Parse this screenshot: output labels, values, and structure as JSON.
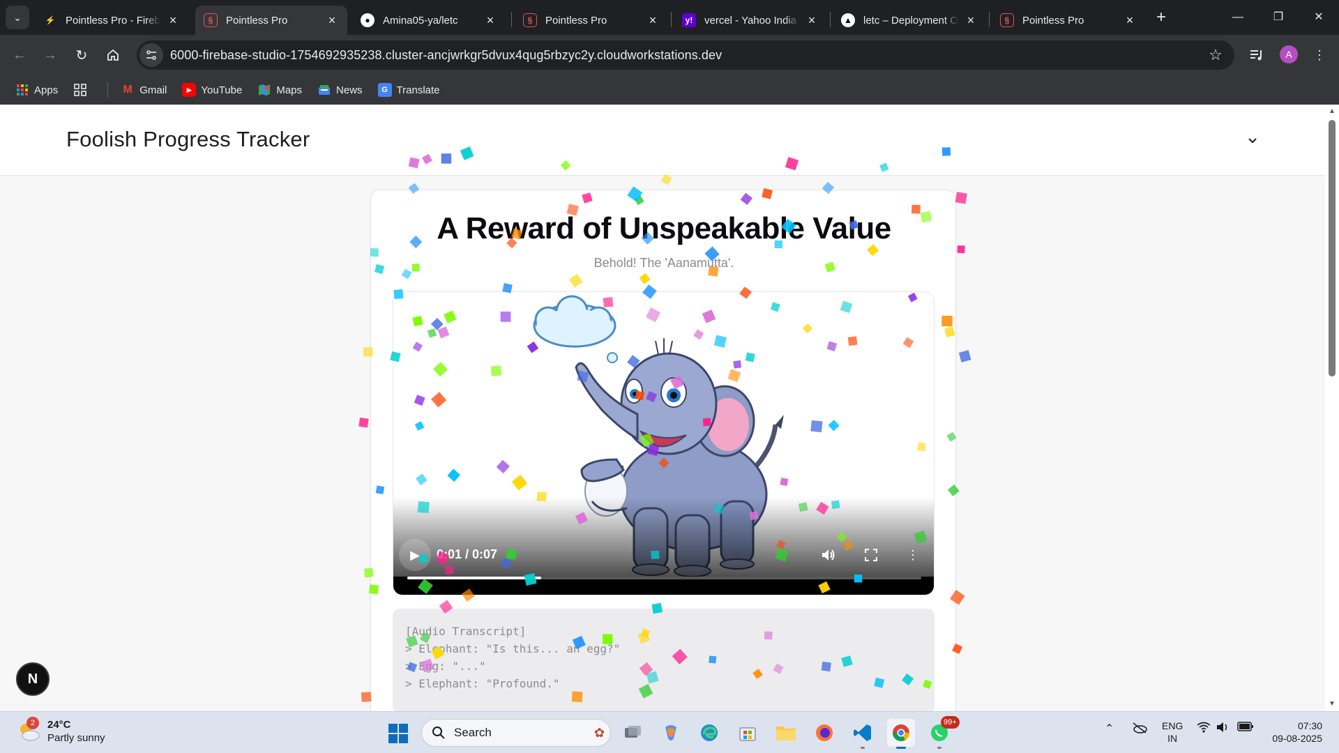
{
  "browser": {
    "tabs": [
      {
        "title": "Pointless Pro - Fireba",
        "favicon": "firebase-icon",
        "active": false
      },
      {
        "title": "Pointless Pro",
        "favicon": "pointless-pro-icon",
        "active": true
      },
      {
        "title": "Amina05-ya/letc",
        "favicon": "github-icon",
        "active": false
      },
      {
        "title": "Pointless Pro",
        "favicon": "pointless-pro-icon",
        "active": false
      },
      {
        "title": "vercel - Yahoo India S",
        "favicon": "yahoo-icon",
        "active": false
      },
      {
        "title": "letc – Deployment O",
        "favicon": "vercel-icon",
        "active": false
      },
      {
        "title": "Pointless Pro",
        "favicon": "pointless-pro-icon",
        "active": false
      }
    ],
    "url": "6000-firebase-studio-1754692935238.cluster-ancjwrkgr5dvux4qug5rbzyc2y.cloudworkstations.dev",
    "profile_initial": "A",
    "bookmarks": [
      {
        "label": "Apps",
        "icon": "apps-grid-icon"
      },
      {
        "label": "Gmail",
        "icon": "gmail-icon"
      },
      {
        "label": "YouTube",
        "icon": "youtube-icon"
      },
      {
        "label": "Maps",
        "icon": "maps-icon"
      },
      {
        "label": "News",
        "icon": "news-icon"
      },
      {
        "label": "Translate",
        "icon": "translate-icon"
      }
    ]
  },
  "page": {
    "app_title": "Foolish Progress Tracker",
    "card": {
      "title": "A Reward of Unspeakable Value",
      "subtitle": "Behold! The 'Aanamutta'."
    },
    "video": {
      "time": "0:01 / 0:07",
      "progress_fraction": 0.26
    },
    "transcript": [
      "[Audio Transcript]",
      "> Elephant: \"Is this... an egg?\"",
      "> Egg: \"...\"",
      "> Elephant: \"Profound.\""
    ],
    "floating_badge": "N"
  },
  "taskbar": {
    "weather": {
      "temp": "24°C",
      "condition": "Partly sunny",
      "badge": "2"
    },
    "search_label": "Search",
    "whatsapp_badge": "99+",
    "lang_line1": "ENG",
    "lang_line2": "IN",
    "time": "07:30",
    "date": "09-08-2025"
  },
  "colors": {
    "accent_blue": "#0f6cbd",
    "chrome_dark": "#35363a",
    "confetti": [
      "#ff1f8e",
      "#8a2be2",
      "#ff4500",
      "#1e90ff",
      "#32cd32",
      "#ffd700",
      "#00bfff",
      "#ff8c00",
      "#7cfc00",
      "#da70d6",
      "#4169e1",
      "#00ced1"
    ]
  }
}
